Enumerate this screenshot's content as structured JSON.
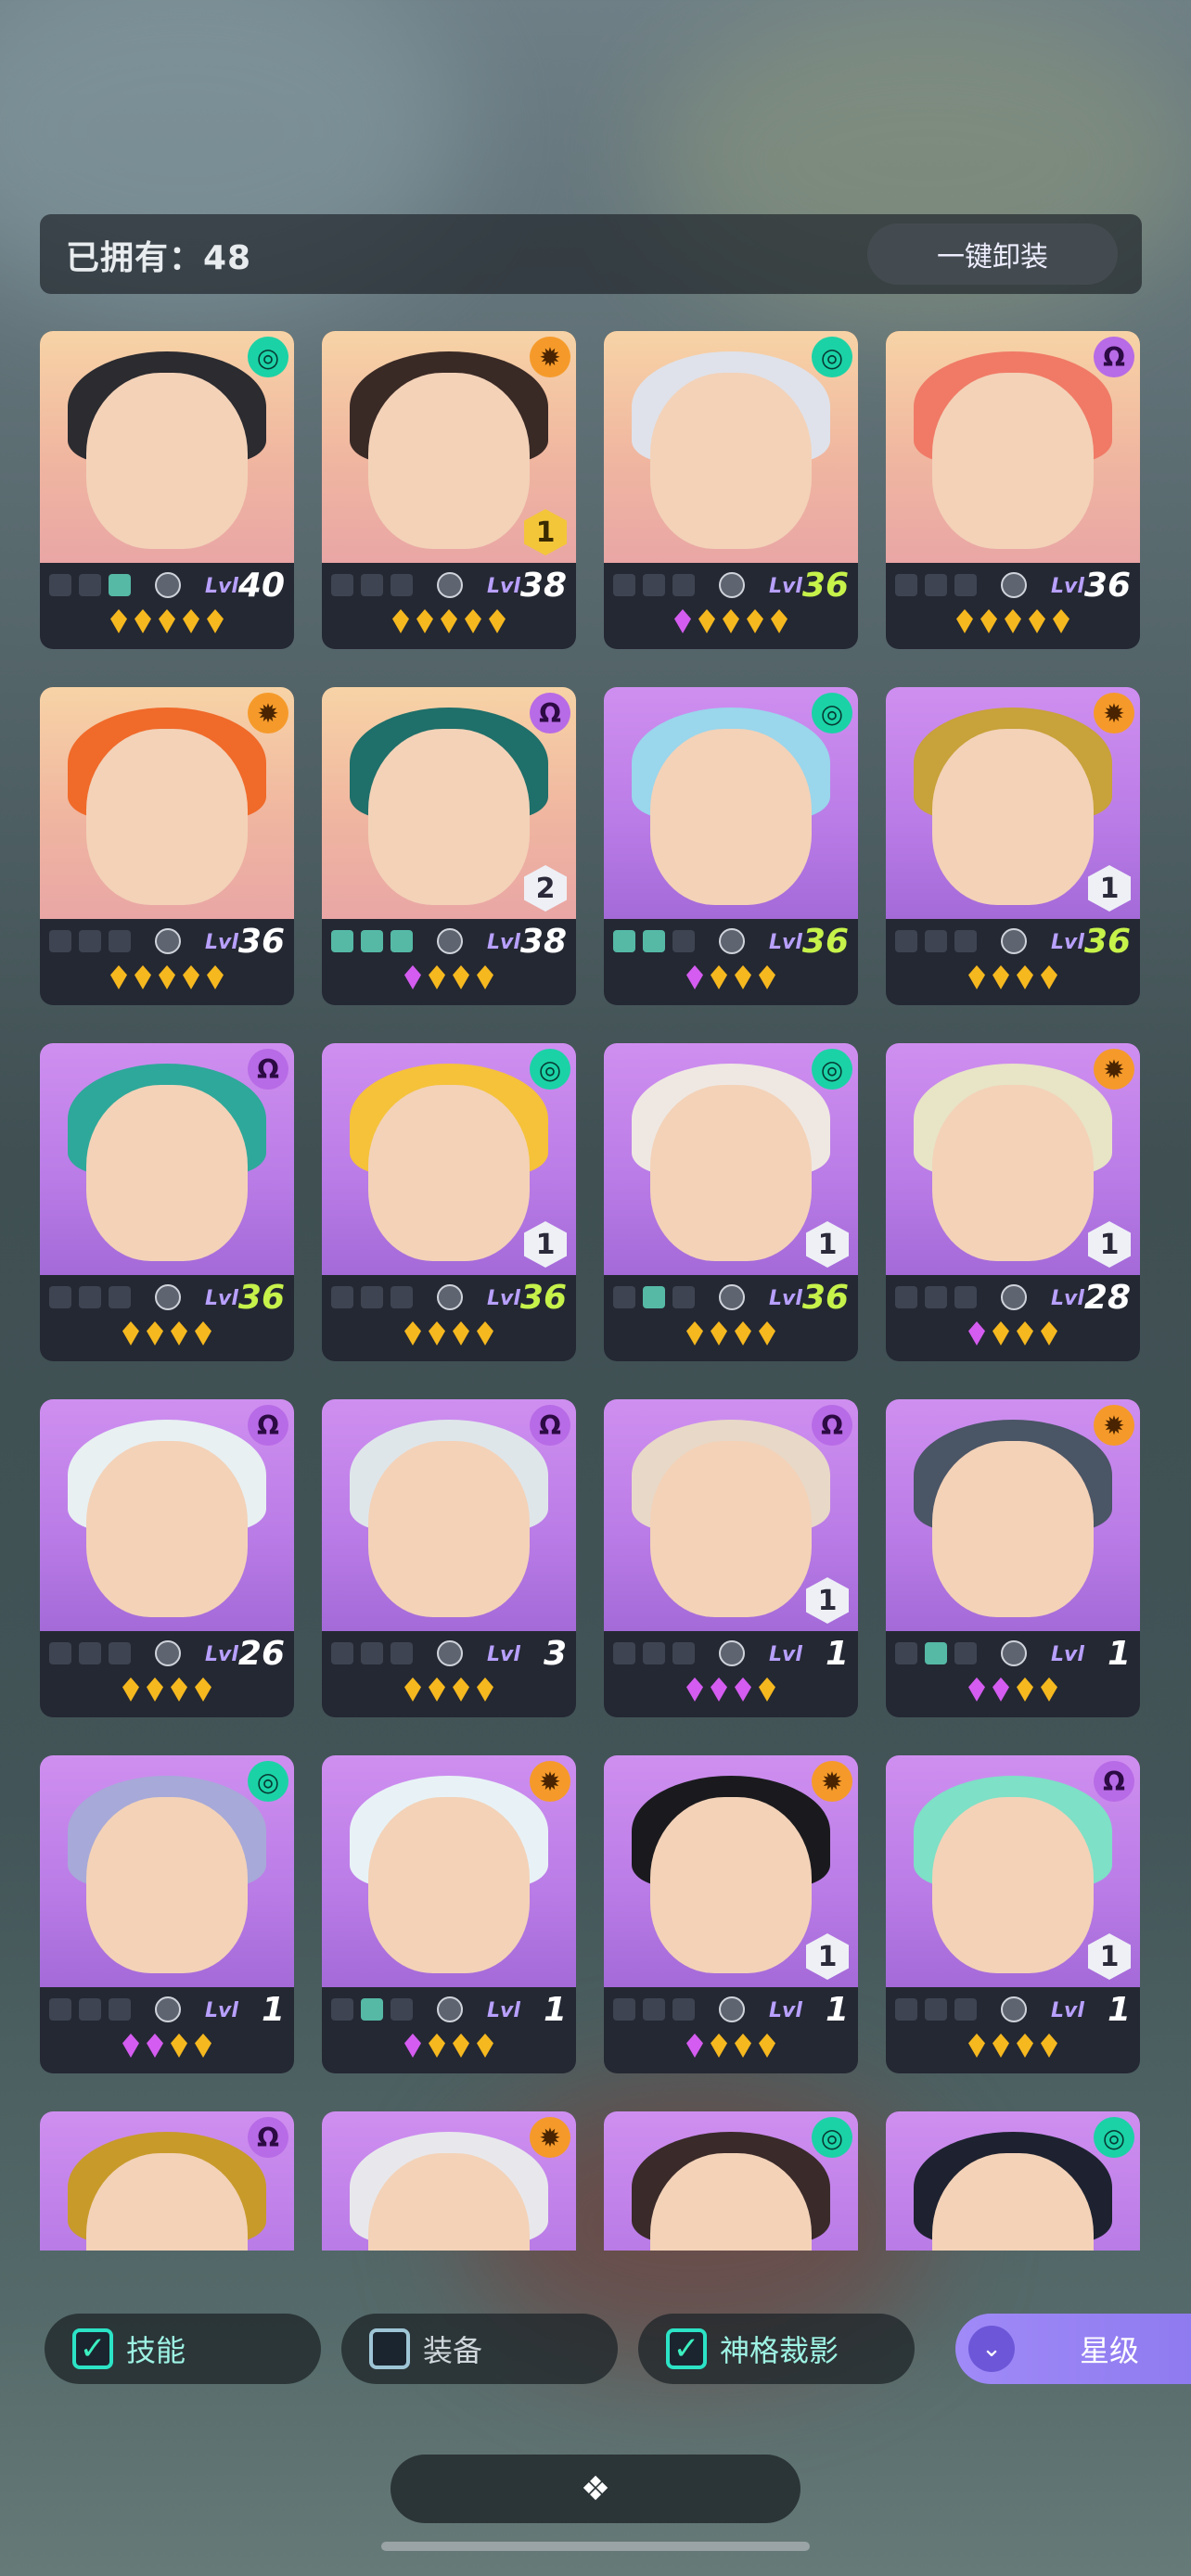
{
  "header": {
    "owned_text": "已拥有：48",
    "unequip_label": "一键卸装"
  },
  "colors": {
    "faction_teal": "#1bd2a6",
    "faction_orange": "#f59a2a",
    "faction_purple": "#b86be6",
    "level_green": "#c6f24a",
    "gem_gold": "#f5b81f",
    "gem_purple": "#d45cf0"
  },
  "cards": [
    {
      "faction": "teal",
      "rank": "",
      "bg": "gold",
      "level": "40",
      "lvl_color": "white",
      "slots": [
        0,
        0,
        1
      ],
      "gems": [
        "g",
        "g",
        "g",
        "g",
        "g"
      ]
    },
    {
      "faction": "orange",
      "rank": "1",
      "rank_style": "gold",
      "bg": "gold",
      "level": "38",
      "lvl_color": "white",
      "slots": [
        0,
        0,
        0
      ],
      "gems": [
        "g",
        "g",
        "g",
        "g",
        "g"
      ]
    },
    {
      "faction": "teal",
      "rank": "",
      "bg": "gold",
      "level": "36",
      "lvl_color": "green",
      "slots": [
        0,
        0,
        0
      ],
      "gems": [
        "p",
        "g",
        "g",
        "g",
        "g"
      ]
    },
    {
      "faction": "purple",
      "rank": "",
      "bg": "gold",
      "level": "36",
      "lvl_color": "white",
      "slots": [
        0,
        0,
        0
      ],
      "gems": [
        "g",
        "g",
        "g",
        "g",
        "g"
      ]
    },
    {
      "faction": "orange",
      "rank": "",
      "bg": "gold",
      "level": "36",
      "lvl_color": "white",
      "slots": [
        0,
        0,
        0
      ],
      "gems": [
        "g",
        "g",
        "g",
        "g",
        "g"
      ]
    },
    {
      "faction": "purple",
      "rank": "2",
      "rank_style": "white",
      "bg": "gold",
      "level": "38",
      "lvl_color": "white",
      "slots": [
        1,
        1,
        1
      ],
      "gems": [
        "p",
        "g",
        "g",
        "g"
      ]
    },
    {
      "faction": "teal",
      "rank": "",
      "bg": "purple",
      "level": "36",
      "lvl_color": "green",
      "slots": [
        1,
        1,
        0
      ],
      "gems": [
        "p",
        "g",
        "g",
        "g"
      ]
    },
    {
      "faction": "orange",
      "rank": "1",
      "rank_style": "white",
      "bg": "purple",
      "level": "36",
      "lvl_color": "green",
      "slots": [
        0,
        0,
        0
      ],
      "gems": [
        "g",
        "g",
        "g",
        "g"
      ]
    },
    {
      "faction": "purple",
      "rank": "",
      "bg": "purple",
      "level": "36",
      "lvl_color": "green",
      "slots": [
        0,
        0,
        0
      ],
      "gems": [
        "g",
        "g",
        "g",
        "g"
      ]
    },
    {
      "faction": "teal",
      "rank": "1",
      "rank_style": "white",
      "bg": "purple",
      "level": "36",
      "lvl_color": "green",
      "slots": [
        0,
        0,
        0
      ],
      "gems": [
        "g",
        "g",
        "g",
        "g"
      ]
    },
    {
      "faction": "teal",
      "rank": "1",
      "rank_style": "white",
      "bg": "purple",
      "level": "36",
      "lvl_color": "green",
      "slots": [
        0,
        1,
        0
      ],
      "gems": [
        "g",
        "g",
        "g",
        "g"
      ]
    },
    {
      "faction": "orange",
      "rank": "1",
      "rank_style": "white",
      "bg": "purple",
      "level": "28",
      "lvl_color": "white",
      "slots": [
        0,
        0,
        0
      ],
      "gems": [
        "p",
        "g",
        "g",
        "g"
      ]
    },
    {
      "faction": "purple",
      "rank": "",
      "bg": "purple",
      "level": "26",
      "lvl_color": "white",
      "slots": [
        0,
        0,
        0
      ],
      "gems": [
        "g",
        "g",
        "g",
        "g"
      ]
    },
    {
      "faction": "purple",
      "rank": "",
      "bg": "purple",
      "level": "3",
      "lvl_color": "white",
      "slots": [
        0,
        0,
        0
      ],
      "gems": [
        "g",
        "g",
        "g",
        "g"
      ]
    },
    {
      "faction": "purple",
      "rank": "1",
      "rank_style": "white",
      "bg": "purple",
      "level": "1",
      "lvl_color": "white",
      "slots": [
        0,
        0,
        0
      ],
      "gems": [
        "p",
        "p",
        "p",
        "g"
      ]
    },
    {
      "faction": "orange",
      "rank": "",
      "bg": "purple",
      "level": "1",
      "lvl_color": "white",
      "slots": [
        0,
        1,
        0
      ],
      "gems": [
        "p",
        "p",
        "g",
        "g"
      ]
    },
    {
      "faction": "teal",
      "rank": "",
      "bg": "purple",
      "level": "1",
      "lvl_color": "white",
      "slots": [
        0,
        0,
        0
      ],
      "gems": [
        "p",
        "p",
        "g",
        "g"
      ]
    },
    {
      "faction": "orange",
      "rank": "",
      "bg": "purple",
      "level": "1",
      "lvl_color": "white",
      "slots": [
        0,
        1,
        0
      ],
      "gems": [
        "p",
        "g",
        "g",
        "g"
      ]
    },
    {
      "faction": "orange",
      "rank": "1",
      "rank_style": "white",
      "bg": "purple",
      "level": "1",
      "lvl_color": "white",
      "slots": [
        0,
        0,
        0
      ],
      "gems": [
        "p",
        "g",
        "g",
        "g"
      ]
    },
    {
      "faction": "purple",
      "rank": "1",
      "rank_style": "white",
      "bg": "purple",
      "level": "1",
      "lvl_color": "white",
      "slots": [
        0,
        0,
        0
      ],
      "gems": [
        "g",
        "g",
        "g",
        "g"
      ]
    },
    {
      "faction": "purple",
      "rank": "",
      "bg": "purple",
      "level": "",
      "lvl_color": "white",
      "slots": [],
      "gems": []
    },
    {
      "faction": "orange",
      "rank": "",
      "bg": "purple",
      "level": "",
      "lvl_color": "white",
      "slots": [],
      "gems": []
    },
    {
      "faction": "teal",
      "rank": "",
      "bg": "purple",
      "level": "",
      "lvl_color": "white",
      "slots": [],
      "gems": []
    },
    {
      "faction": "teal",
      "rank": "",
      "bg": "purple",
      "level": "",
      "lvl_color": "white",
      "slots": [],
      "gems": []
    }
  ],
  "lvl_prefix": "Lvl",
  "filters": [
    {
      "label": "技能",
      "checked": true
    },
    {
      "label": "装备",
      "checked": false
    },
    {
      "label": "神格裁影",
      "checked": true
    }
  ],
  "sort_button": {
    "label": "星级",
    "icon": "double-chevron-down-icon"
  },
  "bottom_button": {
    "icon": "collapse-diamond-icon"
  }
}
